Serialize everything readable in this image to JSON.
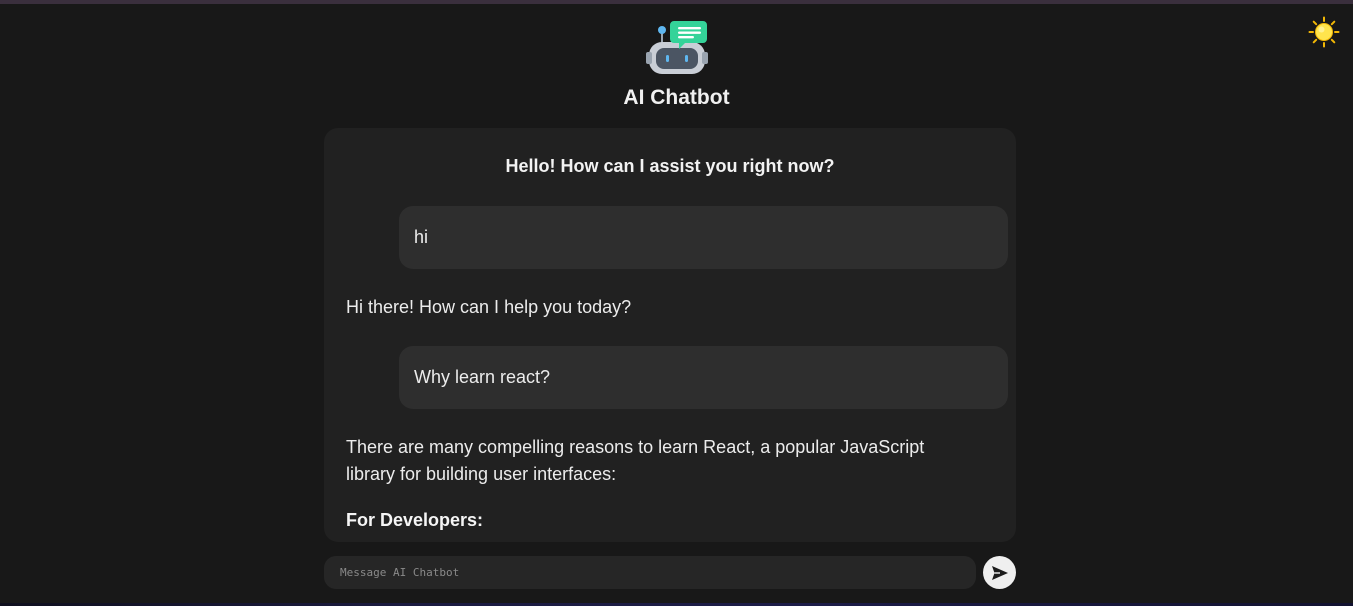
{
  "app": {
    "title": "AI Chatbot",
    "logo_icon": "robot-chat-icon",
    "theme_toggle_icon": "sun-icon"
  },
  "chat": {
    "greeting": "Hello! How can I assist you right now?",
    "messages": [
      {
        "role": "user",
        "text": "hi"
      },
      {
        "role": "bot",
        "text": "Hi there! How can I help you today?"
      },
      {
        "role": "user",
        "text": "Why learn react?"
      },
      {
        "role": "bot",
        "text": "There are many compelling reasons to learn React, a popular JavaScript library for building user interfaces:"
      },
      {
        "role": "bot",
        "text": "For Developers:"
      }
    ]
  },
  "composer": {
    "placeholder": "Message AI Chatbot",
    "value": "",
    "send_icon": "send-arrow-icon"
  },
  "colors": {
    "background": "#181818",
    "panel": "#212121",
    "user_bubble": "#2e2e2e",
    "accent_green": "#34d399"
  }
}
